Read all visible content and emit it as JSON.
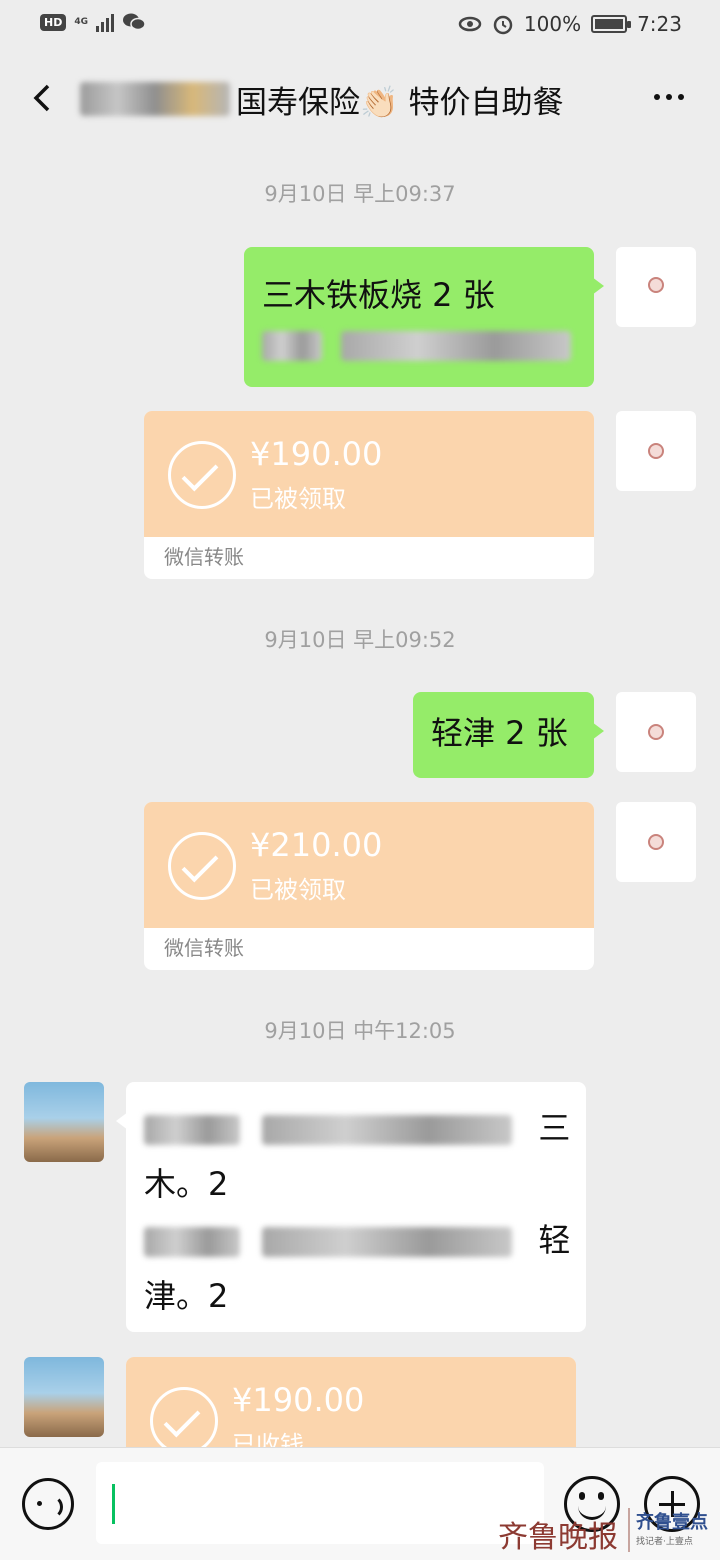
{
  "status_bar": {
    "hd": "HD",
    "network": "4G",
    "battery": "100%",
    "time": "7:23"
  },
  "header": {
    "title": "国寿保险👏🏻 特价自助餐"
  },
  "messages": {
    "ts1": "9月10日 早上09:37",
    "m1_text": "三木铁板烧 2 张",
    "t1_amount": "¥190.00",
    "t1_status": "已被领取",
    "t1_footer": "微信转账",
    "ts2": "9月10日 早上09:52",
    "m2_text": "轻津 2 张",
    "t2_amount": "¥210.00",
    "t2_status": "已被领取",
    "t2_footer": "微信转账",
    "ts3": "9月10日 中午12:05",
    "m3_line1_tail": "三",
    "m3_line2": "木。2",
    "m3_line3_tail": "轻",
    "m3_line4": "津。2",
    "t3_amount": "¥190.00",
    "t3_status": "已收钱"
  },
  "watermark": {
    "name": "齐鲁晚报",
    "brand": "齐鲁壹点",
    "tagline": "找记者·上壹点"
  }
}
